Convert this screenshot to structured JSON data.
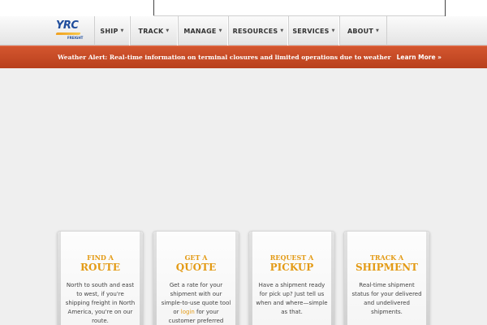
{
  "logo": {
    "text": "YRC",
    "sub": "FREIGHT"
  },
  "nav": [
    {
      "label": "SHIP"
    },
    {
      "label": "TRACK"
    },
    {
      "label": "MANAGE"
    },
    {
      "label": "RESOURCES"
    },
    {
      "label": "SERVICES"
    },
    {
      "label": "ABOUT"
    }
  ],
  "caret": "▼",
  "alert": {
    "message": "Weather Alert: Real-time information on terminal closures and limited operations due to weather",
    "link": "Learn More »"
  },
  "cards": [
    {
      "line1": "FIND A",
      "line2": "ROUTE",
      "desc": "North to south and east to west, if you're shipping freight in North America, you're on our route."
    },
    {
      "line1": "GET A",
      "line2": "QUOTE",
      "desc_pre": "Get a rate for your shipment with our simple-to-use quote tool or ",
      "desc_link": "login",
      "desc_post": " for your customer preferred pricing."
    },
    {
      "line1": "REQUEST A",
      "line2": "PICKUP",
      "desc": "Have a shipment ready for pick up? Just tell us when and where—simple as that."
    },
    {
      "line1": "TRACK A",
      "line2": "SHIPMENT",
      "desc": "Real-time shipment status for your delivered and undelivered shipments."
    }
  ],
  "colors": {
    "accent": "#e39a14",
    "alert": "#c44a24",
    "brand": "#1f4d9c"
  }
}
